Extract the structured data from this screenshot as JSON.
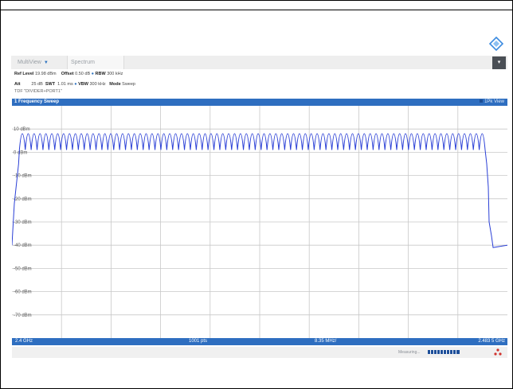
{
  "window": {
    "tab_multiview": "MultiView",
    "tab_spectrum": "Spectrum"
  },
  "info": {
    "ref_level_label": "Ref Level",
    "ref_level_value": "19.98 dBm",
    "offset_label": "Offset",
    "offset_value": "0.50 dB",
    "rbw_label": "RBW",
    "rbw_value": "300 kHz",
    "att_label": "Att",
    "att_value": "25 dB",
    "swt_label": "SWT",
    "swt_value": "1.01 ms",
    "vbw_label": "VBW",
    "vbw_value": "300 kHz",
    "mode_label": "Mode",
    "mode_value": "Sweep",
    "tdf": "TDF \"DIVIDER+PORT1\""
  },
  "panel": {
    "title": "1 Frequency Sweep",
    "view_label": "1Pk View"
  },
  "axis": {
    "y_labels": [
      "10 dBm",
      "0 dBm",
      "-10 dBm",
      "-20 dBm",
      "-30 dBm",
      "-40 dBm",
      "-50 dBm",
      "-60 dBm",
      "-70 dBm"
    ],
    "start": "2.4 GHz",
    "points": "1001 pts",
    "span_div": "8.35 MHz/",
    "stop": "2.483 5 GHz"
  },
  "status": {
    "measuring": "Measuring..."
  },
  "colors": {
    "trace": "#2a3fd6",
    "header": "#2e6ec0",
    "grid": "#c8c8c8"
  },
  "chart_data": {
    "type": "line",
    "title": "1 Frequency Sweep",
    "x_unit": "GHz",
    "xlim": [
      2.4,
      2.4835
    ],
    "ylim": [
      -80,
      20
    ],
    "y_unit": "dBm",
    "grid": true,
    "series": [
      {
        "comb_channel_count": 79,
        "peak_dbm": 8,
        "null_dbm": 1,
        "edge_start_dbm": -40,
        "edge_stop_dbm": -40
      }
    ]
  }
}
